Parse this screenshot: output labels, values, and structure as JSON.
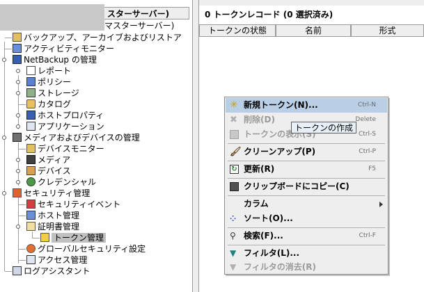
{
  "left_panel": {
    "header_title": "スターサーバー)",
    "tree": [
      {
        "id": "master-server",
        "label": "マスターサーバー)",
        "icon": "server-icon"
      },
      {
        "id": "backup-archive-restore",
        "label": "バックアップ、アーカイブおよびリストア",
        "icon": "backup-icon"
      },
      {
        "id": "activity-monitor",
        "label": "アクティビティモニター",
        "icon": "monitor-icon"
      },
      {
        "id": "netbackup-admin",
        "label": "NetBackup の管理",
        "icon": "netbackup-icon"
      },
      {
        "id": "reports",
        "label": "レポート",
        "icon": "report-icon"
      },
      {
        "id": "policies",
        "label": "ポリシー",
        "icon": "policy-icon"
      },
      {
        "id": "storage",
        "label": "ストレージ",
        "icon": "storage-icon"
      },
      {
        "id": "catalog",
        "label": "カタログ",
        "icon": "catalog-icon"
      },
      {
        "id": "host-properties",
        "label": "ホストプロパティ",
        "icon": "host-properties-icon"
      },
      {
        "id": "applications",
        "label": "アプリケーション",
        "icon": "application-icon"
      },
      {
        "id": "media-device-admin",
        "label": "メディアおよびデバイスの管理",
        "icon": "media-device-icon"
      },
      {
        "id": "device-monitor",
        "label": "デバイスモニター",
        "icon": "device-monitor-icon"
      },
      {
        "id": "media",
        "label": "メディア",
        "icon": "media-icon"
      },
      {
        "id": "devices",
        "label": "デバイス",
        "icon": "device-icon"
      },
      {
        "id": "credentials",
        "label": "クレデンシャル",
        "icon": "credential-icon"
      },
      {
        "id": "security-admin",
        "label": "セキュリティ管理",
        "icon": "security-icon"
      },
      {
        "id": "security-events",
        "label": "セキュリティイベント",
        "icon": "security-event-icon"
      },
      {
        "id": "host-management",
        "label": "ホスト管理",
        "icon": "host-icon"
      },
      {
        "id": "certificate-management",
        "label": "証明書管理",
        "icon": "certificate-icon"
      },
      {
        "id": "token-management",
        "label": "トークン管理",
        "icon": "token-icon"
      },
      {
        "id": "global-security-settings",
        "label": "グローバルセキュリティ設定",
        "icon": "gear-icon"
      },
      {
        "id": "access-management",
        "label": "アクセス管理",
        "icon": "access-icon"
      },
      {
        "id": "log-assistant",
        "label": "ログアシスタント",
        "icon": "log-icon"
      }
    ]
  },
  "right_panel": {
    "title": "0 トークンレコード (0 選択済み)",
    "columns": [
      "トークンの状態",
      "名前",
      "形式"
    ]
  },
  "context_menu": {
    "items": [
      {
        "label": "新規トークン(N)...",
        "accel": "Ctrl-N",
        "icon": "new-star-icon",
        "enabled": true,
        "highlighted": true
      },
      {
        "label": "削除(D)",
        "accel": "Delete",
        "icon": "delete-icon",
        "enabled": false
      },
      {
        "label": "トークンの表示(S)",
        "accel": "Ctrl-S",
        "icon": "view-token-icon",
        "enabled": false
      },
      {
        "label": "クリーンアップ(P)",
        "accel": "Ctrl-P",
        "icon": "broom-icon",
        "enabled": true
      },
      {
        "label": "更新(R)",
        "accel": "F5",
        "icon": "refresh-icon",
        "enabled": true
      },
      {
        "label": "クリップボードにコピー(C)",
        "accel": "",
        "icon": "clipboard-icon",
        "enabled": true
      },
      {
        "label": "カラム",
        "accel": "",
        "icon": "",
        "enabled": true,
        "submenu": true
      },
      {
        "label": "ソート(O)...",
        "accel": "",
        "icon": "sort-icon",
        "enabled": true
      },
      {
        "label": "検索(F)...",
        "accel": "Ctrl-F",
        "icon": "search-icon",
        "enabled": true
      },
      {
        "label": "フィルタ(L)...",
        "accel": "",
        "icon": "filter-icon",
        "enabled": true
      },
      {
        "label": "フィルタの消去(R)",
        "accel": "",
        "icon": "filter-clear-icon",
        "enabled": false
      }
    ]
  },
  "tooltip": {
    "text": "トークンの作成"
  },
  "colors": {
    "highlight": "#b8cfe5",
    "selected_tree": "#c0c0c0",
    "pane_bg": "#eeeeee"
  }
}
